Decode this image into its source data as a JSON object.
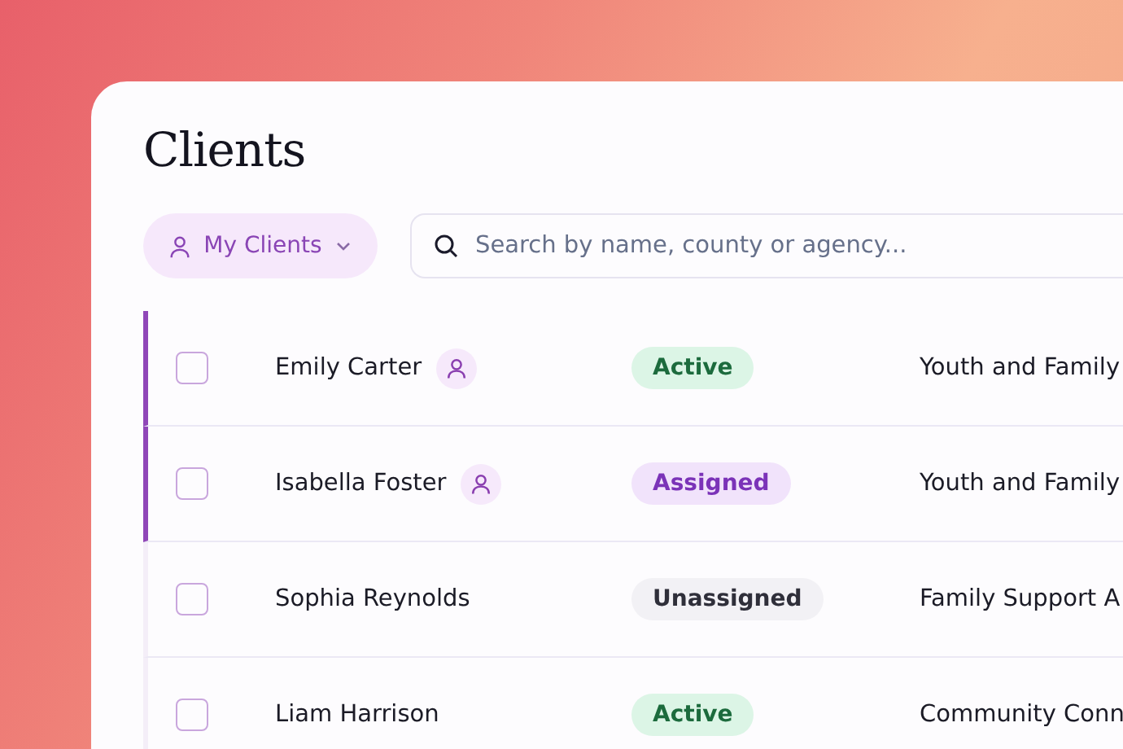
{
  "page": {
    "title": "Clients"
  },
  "filter": {
    "label": "My Clients"
  },
  "search": {
    "placeholder": "Search by name, county or agency..."
  },
  "rows": [
    {
      "name": "Emily Carter",
      "mine": true,
      "checked": false,
      "status": "Active",
      "kind": "active",
      "agency": "Youth and Family"
    },
    {
      "name": "Isabella Foster",
      "mine": true,
      "checked": false,
      "status": "Assigned",
      "kind": "assigned",
      "agency": "Youth and Family"
    },
    {
      "name": "Sophia Reynolds",
      "mine": false,
      "checked": false,
      "status": "Unassigned",
      "kind": "unassigned",
      "agency": "Family Support A"
    },
    {
      "name": "Liam Harrison",
      "mine": false,
      "checked": false,
      "status": "Active",
      "kind": "active",
      "agency": "Community Conn"
    }
  ]
}
